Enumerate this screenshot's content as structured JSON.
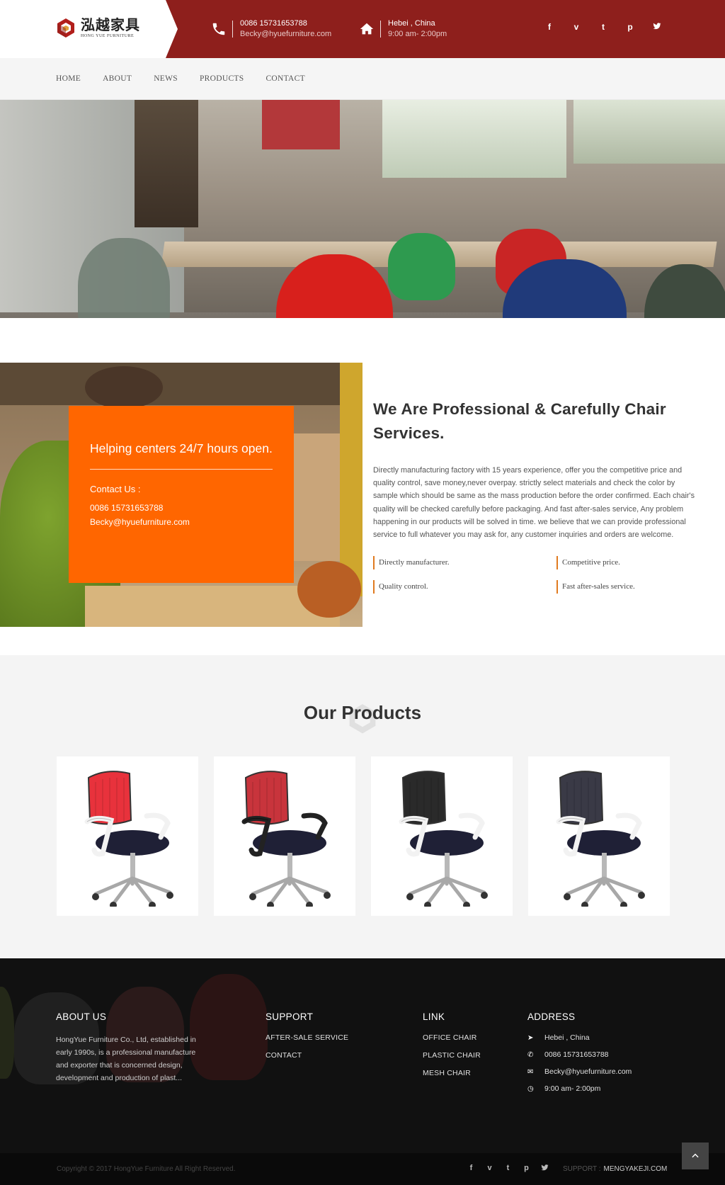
{
  "header": {
    "logo_cn": "泓越家具",
    "logo_en": "HONG YUE FURNITURE",
    "phone": "0086 15731653788",
    "email": "Becky@hyuefurniture.com",
    "location": "Hebei , China",
    "hours": "9:00 am- 2:00pm",
    "social": [
      "f",
      "v",
      "t",
      "p",
      "✓"
    ]
  },
  "nav": {
    "items": [
      "HOME",
      "ABOUT",
      "NEWS",
      "PRODUCTS",
      "CONTACT"
    ]
  },
  "about": {
    "card_headline": "Helping centers 24/7 hours open.",
    "card_contact_label": "Contact Us :",
    "card_phone": "0086 15731653788",
    "card_email": "Becky@hyuefurniture.com",
    "title": "We Are Professional & Carefully Chair Services.",
    "body": "Directly manufacturing factory with 15 years experience, offer you the competitive price and quality control, save money,never overpay. strictly select materials and check the color by sample which should be same as the mass production before the order confirmed. Each chair's quality will be checked carefully before packaging. And fast after-sales service, Any problem happening in our products will be solved in time. we believe that we can provide professional service to full whatever you may ask for, any customer inquiries and orders are welcome.",
    "features": [
      "Directly manufacturer.",
      "Competitive price.",
      "Quality control.",
      "Fast after-sales service."
    ]
  },
  "products": {
    "title": "Our Products",
    "items": [
      {
        "back_color": "#e8323c",
        "frame": "white"
      },
      {
        "back_color": "#c8343c",
        "frame": "black"
      },
      {
        "back_color": "#2a2a2a",
        "frame": "white"
      },
      {
        "back_color": "#3a3a46",
        "frame": "white"
      }
    ]
  },
  "footer": {
    "about_title": "ABOUT US",
    "about_text": "HongYue Furniture Co., Ltd, established in early 1990s, is a professional manufacture and exporter that is concerned design, development and production of plast...",
    "support_title": "SUPPORT",
    "support_links": [
      "AFTER-SALE SERVICE",
      "CONTACT"
    ],
    "link_title": "LINK",
    "link_items": [
      "OFFICE CHAIR",
      "PLASTIC CHAIR",
      "MESH CHAIR"
    ],
    "address_title": "ADDRESS",
    "address": {
      "location": "Hebei , China",
      "phone": "0086 15731653788",
      "email": "Becky@hyuefurniture.com",
      "hours": "9:00 am- 2:00pm"
    },
    "copyright": "Copyright © 2017 HongYue Furniture All Right Reserved.",
    "social": [
      "f",
      "v",
      "t",
      "p",
      "✓"
    ],
    "support_label": "SUPPORT :",
    "support_site": "MENGYAKEJI.COM"
  },
  "colors": {
    "brand_red": "#8e1f1c",
    "accent_orange": "#ff6600"
  }
}
